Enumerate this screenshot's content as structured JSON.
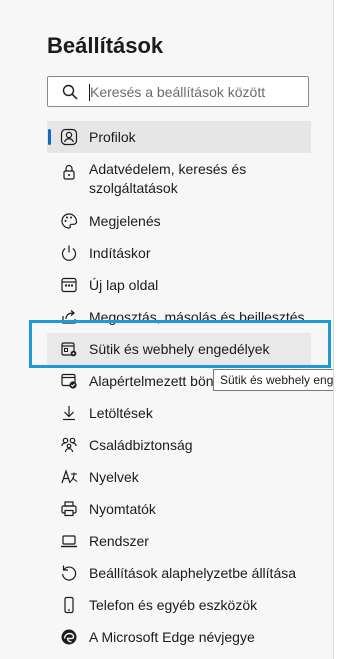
{
  "settings": {
    "title": "Beállítások",
    "search_placeholder": "Keresés a beállítások között",
    "items": [
      {
        "label": "Profilok",
        "icon": "profile-icon"
      },
      {
        "label": "Adatvédelem, keresés és szolgáltatások",
        "icon": "lock-icon"
      },
      {
        "label": "Megjelenés",
        "icon": "palette-icon"
      },
      {
        "label": "Indításkor",
        "icon": "power-icon"
      },
      {
        "label": "Új lap oldal",
        "icon": "new-tab-icon"
      },
      {
        "label": "Megosztás, másolás és beillesztés",
        "icon": "share-icon"
      },
      {
        "label": "Sütik és webhely engedélyek",
        "icon": "cookie-permissions-icon"
      },
      {
        "label": "Alapértelmezett böngésző",
        "icon": "default-browser-icon"
      },
      {
        "label": "Letöltések",
        "icon": "download-icon"
      },
      {
        "label": "Családbiztonság",
        "icon": "family-icon"
      },
      {
        "label": "Nyelvek",
        "icon": "language-icon"
      },
      {
        "label": "Nyomtatók",
        "icon": "printer-icon"
      },
      {
        "label": "Rendszer",
        "icon": "laptop-icon"
      },
      {
        "label": "Beállítások alaphelyzetbe állítása",
        "icon": "reset-icon"
      },
      {
        "label": "Telefon és egyéb eszközök",
        "icon": "phone-icon"
      },
      {
        "label": "A Microsoft Edge névjegye",
        "icon": "edge-icon"
      }
    ]
  },
  "tooltip": "Sütik és webhely engedélyek",
  "colors": {
    "accent": "#0f6cbd",
    "highlight": "#1a9bd7"
  }
}
